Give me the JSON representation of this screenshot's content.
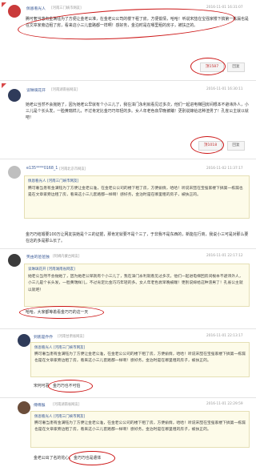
{
  "comment1": {
    "user": "佩恩看光人",
    "location": "[河南三门峡市网友]",
    "time": "2016-11-01 16:31:07",
    "text": "腾可奢当患有金满钰为了方便让金老公准，在金老公公司的楼下租了房，方便偷情，哈哈！听说宋喆在宝强家楼下搞第一栋漏也是在文章家旁边租了房，看来这小三儿套路都一样啊！感好务，金泊时是在哪里租的房子，被扶正的。",
    "likes": "顶1587",
    "reply": "回复"
  },
  "comment2": {
    "user": "谈琳璃花开",
    "location": "[河南湖南省网友]",
    "time": "2016-11-01 16:30:11",
    "text": "她老公当然不会抛她了，因为她老公早就有个小三儿了，我在漳门永利就看见过多次，他们一起进电梯回房间根本不避讳外人，小三儿是个长头发，一脸黄瑞样儿，不过肯定比金巧巧年轻的多。女人年老色衰早晚被踹！更别说嫁给这种渣男了！孔雀公主就以就吧！",
    "likes": "顶1018",
    "reply": "回复"
  },
  "comment3": {
    "user": "e135****0168_1",
    "location": "[河南北京市网友]",
    "time": "2016-11-02 11:37:17",
    "quote_user": "佩恩看光人 [河南三门峡市网友]",
    "quote_text": "腾可奢当患有金满钰为了方便让金老公准，在金老公公司的楼下租了房，方便偷情，哈哈！听说宋喆在宝强家楼下搞第一栋漏也是在文章家旁边租了房，看来这小三儿套路都一样啊！感好务，金泊时是在哪里租的房子，被扶正的。",
    "text": "金巧巧结婚要100万让网友扶她是个三的证据，那肯定就要不是个三了，于非我不是东西的，新能在行商，我说小三可是对那么要在这的多是那么长了。"
  },
  "comment4": {
    "user": "笑由的爸爸独",
    "location": "[阿姆内蒙古网友]",
    "time": "2016-11-01 22:17:12",
    "quote_user": "谈琳璃花开 [河南湖南省网友]",
    "quote_text": "她老公当然不会抛她了，因为她老公早就有个小三儿了，我在漳门永利就看见过多次，他们一起进电梯回房间根本不避讳外人，小三儿是个长头发，一脸黄瑞样儿，不过肯定比金巧巧年轻的多。女人年老色衰早晚被踹！更别说嫁给这种渣男了！孔雀公主就以就吧！",
    "text": "哈哈，大家都等着看金巧巧的这一天"
  },
  "comment5": {
    "user": "到底是乔乔",
    "location": "[河南甘肃省网友]",
    "time": "2016-11-01 22:13:17",
    "quote_user": "佩恩看光人 [河南三门峡市网友]",
    "quote_text": "腾可奢当患有金满钰为了方便让金老公准，在金老公公司的楼下租了房，方便偷情，哈哈！听说宋喆在宝强家楼下搞第一栋漏也是在文章家旁边租了房，看来这小三儿套路都一样啊！感好务，金泊时是在哪里租的房子，被扶正的。",
    "text_prefix": "宋何可恶",
    "text_highlight": "金巧巧也不可怕"
  },
  "comment6": {
    "user": "傅傅猴",
    "location": "[河南湖南省网友]",
    "time": "2016-11-01 22:29:59",
    "quote_user": "佩恩看光人 [河南三门峡市网友]",
    "quote_text": "腾可奢当患有金满钰为了方便让金老公准，在金老公公司的楼下租了房，方便偷情，哈哈！听说宋喆在宝强家楼下搞第一栋漏也是在文章家旁边租了房，看来这小三儿套路都一样啊！感好务，金泊时是在哪里租的房子，被扶正的。",
    "text_prefix": "金老公出了名的花心，",
    "text_highlight": "金巧巧也是遣体"
  },
  "colors": {
    "annotation": "#cc1414",
    "username": "#3a5a97",
    "quote_bg": "#fdfbe9"
  }
}
